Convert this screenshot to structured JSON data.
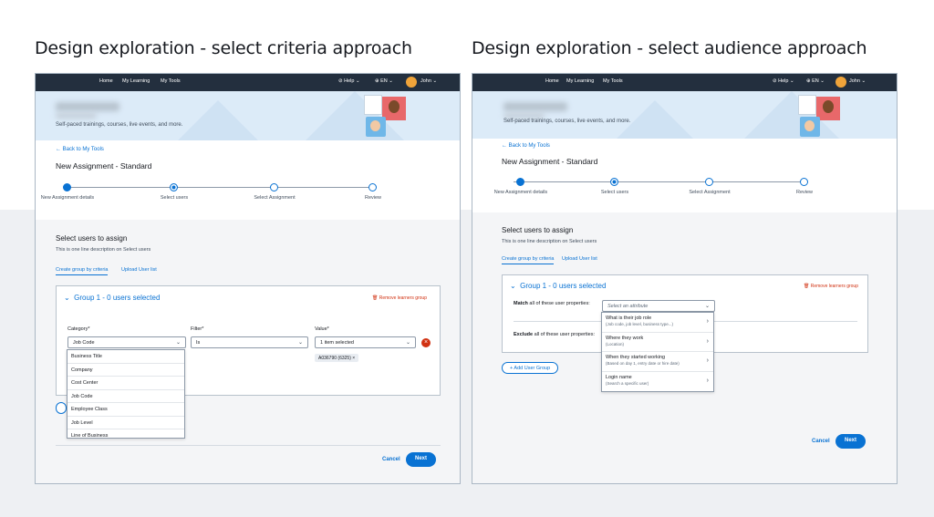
{
  "titles": {
    "left": "Design exploration - select criteria approach",
    "right": "Design exploration - select audience approach"
  },
  "nav": {
    "home": "Home",
    "my_learning": "My Learning",
    "my_tools": "My Tools",
    "help": "Help",
    "lang": "EN",
    "user": "John"
  },
  "banner": {
    "subtitle": "Self-paced trainings, courses, live events, and more."
  },
  "page": {
    "back_link": "Back to My Tools",
    "heading": "New Assignment - Standard"
  },
  "steps": [
    {
      "label": "New Assignment details",
      "state": "done"
    },
    {
      "label": "Select users",
      "state": "current"
    },
    {
      "label": "Select Assignment",
      "state": "todo"
    },
    {
      "label": "Review",
      "state": "todo"
    }
  ],
  "select_users": {
    "heading": "Select users to assign",
    "description": "This is one line description on Select users",
    "tab_create": "Create group by criteria",
    "tab_upload": "Upload User list"
  },
  "group": {
    "title": "Group 1 - 0 users selected",
    "remove": "Remove learners group"
  },
  "criteria": {
    "category_label": "Category*",
    "category_value": "Job Code",
    "filter_label": "Filter*",
    "filter_value": "Is",
    "value_label": "Value*",
    "value_value": "1 item selected",
    "chip": "A036790 (6325)",
    "category_options": [
      "Business Title",
      "Company",
      "Cost Center",
      "Job Code",
      "Employee Class",
      "Job Level",
      "Line of Business"
    ]
  },
  "audience": {
    "match_label_bold": "Match",
    "match_label_rest": "all of these user properties:",
    "exclude_label_bold": "Exclude",
    "exclude_label_rest": "all of these user properties:",
    "placeholder": "Select an attribute",
    "attributes": [
      {
        "title": "What is their job role",
        "sub": "(Job code, job level, business type...)"
      },
      {
        "title": "Where they work",
        "sub": "(Location)"
      },
      {
        "title": "When they started working",
        "sub": "(Based on day 1, entry date or hire date)"
      },
      {
        "title": "Login name",
        "sub": "(Search a specific user)"
      }
    ],
    "add_group": "+ Add User Group"
  },
  "footer": {
    "cancel": "Cancel",
    "next": "Next"
  },
  "icons": {
    "chevron_down": "⌄",
    "chevron_right": "›",
    "close": "×",
    "remove": "✕",
    "check": "✓",
    "arrow_left": "←",
    "trash": "🗑"
  }
}
